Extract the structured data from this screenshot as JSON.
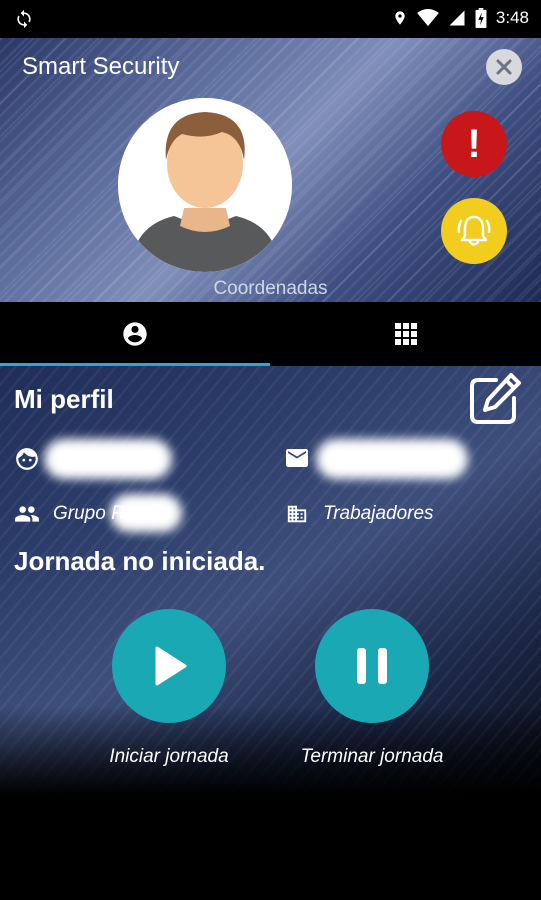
{
  "status_bar": {
    "time": "3:48"
  },
  "header": {
    "app_title": "Smart Security",
    "coords_label": "Coordenadas",
    "alert_symbol": "!"
  },
  "tabs": [
    {
      "icon": "account-circle-icon",
      "active": true
    },
    {
      "icon": "grid-icon",
      "active": false
    }
  ],
  "profile": {
    "title": "Mi perfil",
    "group_label": "Grupo R",
    "category": "Trabajadores",
    "status": "Jornada no iniciada.",
    "start_label": "Iniciar jornada",
    "end_label": "Terminar jornada"
  },
  "colors": {
    "accent_teal": "#1aa8b5",
    "alert_red": "#c8171b",
    "alarm_yellow": "#f2cd1e",
    "tab_indicator": "#29a7dc"
  }
}
